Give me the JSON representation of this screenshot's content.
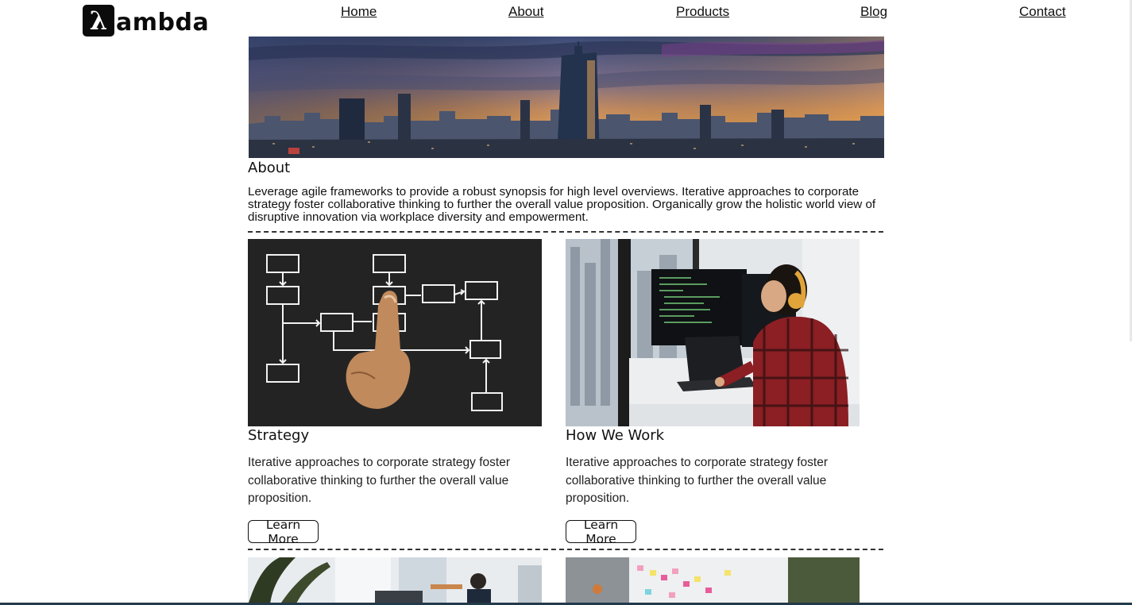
{
  "brand": {
    "logo_glyph": "λ",
    "logo_text": "ambda"
  },
  "nav": {
    "items": [
      "Home",
      "About",
      "Products",
      "Blog",
      "Contact"
    ]
  },
  "about": {
    "title": "About",
    "text": "Leverage agile frameworks to provide a robust synopsis for high level overviews. Iterative approaches to corporate strategy foster collaborative thinking to further the overall value proposition. Organically grow the holistic world view of disruptive innovation via workplace diversity and empowerment."
  },
  "cards": [
    {
      "title": "Strategy",
      "text": "Iterative approaches to corporate strategy foster collaborative thinking to further the overall value proposition.",
      "button": "Learn More",
      "image_icon": "flowchart-photo"
    },
    {
      "title": "How We Work",
      "text": "Iterative approaches to corporate strategy foster collaborative thinking to further the overall value proposition.",
      "button": "Learn More",
      "image_icon": "developer-workstation-photo"
    }
  ],
  "colors": {
    "text": "#111111",
    "divider": "#333333",
    "logo_bg": "#0b0b0b"
  }
}
